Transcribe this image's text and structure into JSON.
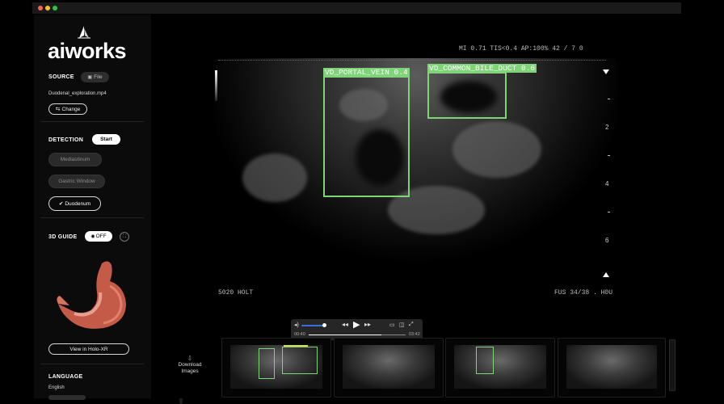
{
  "sidebar": {
    "logo_text": "aiworks",
    "source": {
      "title": "SOURCE",
      "file_badge": "File",
      "file_name": "Duodenal_exploration.mp4",
      "change_label": "Change"
    },
    "detection": {
      "title": "DETECTION",
      "start_label": "Start",
      "options": [
        "Mediastinum",
        "Gastric Window",
        "Duodenum"
      ],
      "selected": "Duodenum"
    },
    "guide": {
      "title": "3D GUIDE",
      "toggle_label": "OFF",
      "view_button": "View in Holo-XR"
    },
    "language": {
      "title": "LANGUAGE",
      "value": "English"
    }
  },
  "ultrasound": {
    "header_text": "MI 0.71  TIS<0.4  AP:100%      42 / 7 0",
    "depth_marks": [
      "2",
      "4",
      "6"
    ],
    "bottom_left": "5020 HOLT",
    "bottom_right": "FUS 34/38 . H0U",
    "detections": [
      {
        "label": "VD_PORTAL_VEIN",
        "score": "0.4"
      },
      {
        "label": "VD_COMMON_BILE_DUCT",
        "score": "0.6"
      }
    ],
    "box_color": "#7ed477"
  },
  "player": {
    "time_current": "00:40",
    "time_total": "03:42",
    "progress": 0.75
  },
  "gallery": {
    "download_label": "Download Images",
    "thumbnail_count": 4
  }
}
